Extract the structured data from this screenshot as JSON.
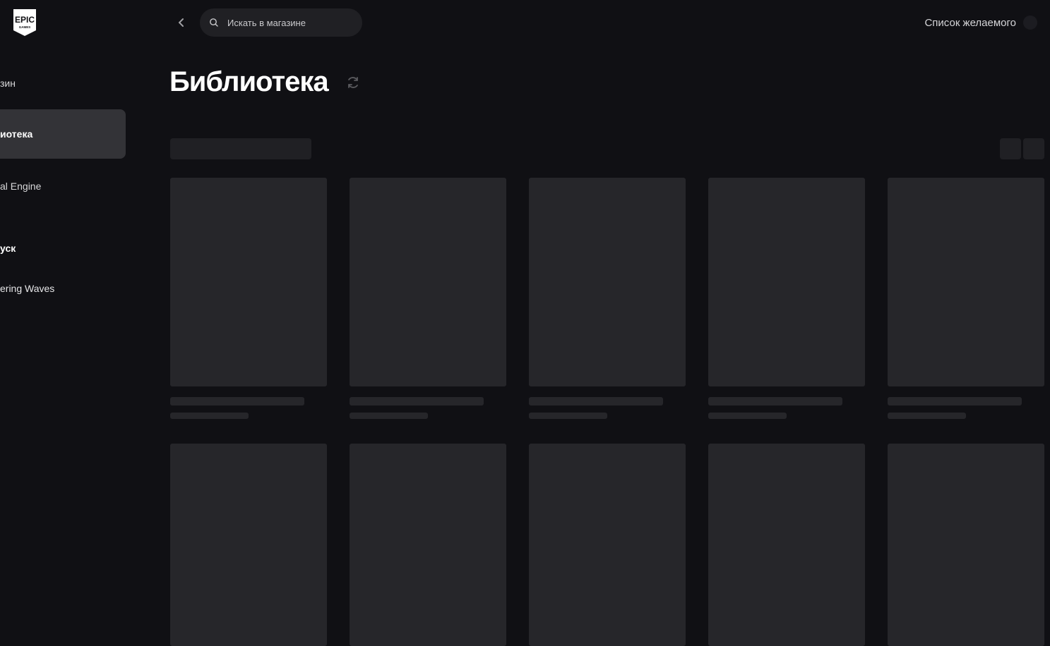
{
  "sidebar": {
    "items": [
      {
        "label": "Магазин",
        "visible_text": "зин"
      },
      {
        "label": "Библиотека",
        "visible_text": "иотека"
      },
      {
        "label": "Unreal Engine",
        "visible_text": "al Engine"
      },
      {
        "label": "Быстрый запуск",
        "visible_text": "уск"
      },
      {
        "label": "Wuthering Waves",
        "visible_text": "ering Waves"
      }
    ]
  },
  "header": {
    "search_placeholder": "Искать в магазине",
    "wishlist_label": "Список желаемого"
  },
  "main": {
    "title": "Библиотека"
  },
  "icons": {
    "logo": "epic-games-logo",
    "back": "chevron-left-icon",
    "search": "search-icon",
    "refresh": "refresh-icon"
  },
  "logo": {
    "top_text": "EPIC",
    "bottom_text": "GAMES"
  },
  "colors": {
    "background": "#101014",
    "skeleton": "#26262a",
    "active_nav": "#333337",
    "search_bg": "#202024"
  }
}
